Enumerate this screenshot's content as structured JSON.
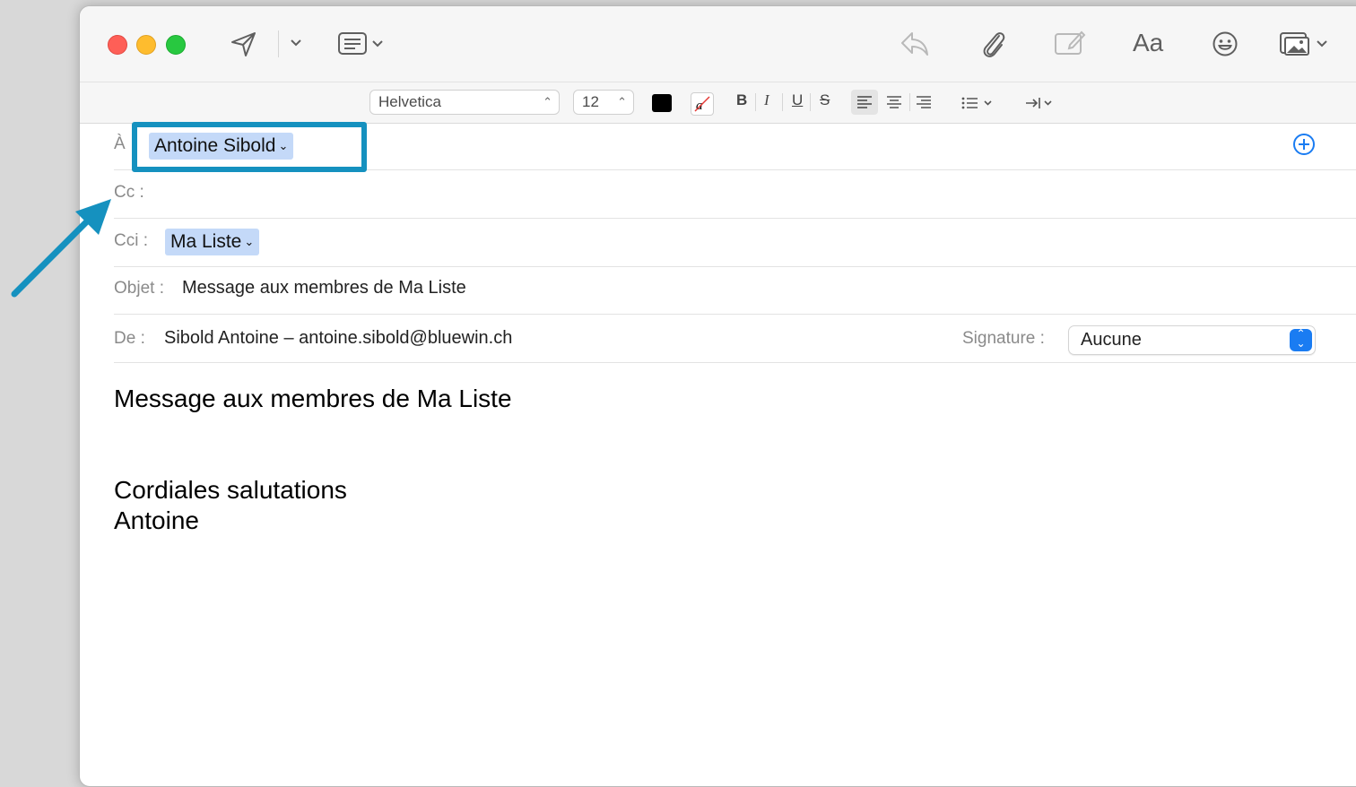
{
  "toolbar": {
    "font_size_glyph": "Aa",
    "icons": [
      "send-icon",
      "chevron-down-icon",
      "header-fields-icon",
      "reply-icon",
      "attachment-icon",
      "markup-icon",
      "font-icon",
      "emoji-icon",
      "photo-browser-icon"
    ]
  },
  "format_bar": {
    "font_family": "Helvetica",
    "font_size": "12",
    "text_color": "#000000",
    "bold": "B",
    "italic": "I",
    "underline": "U",
    "strikethrough": "S"
  },
  "fields": {
    "to_label": "À",
    "to_recipient": "Antoine Sibold",
    "cc_label": "Cc :",
    "bcc_label": "Cci :",
    "bcc_recipient": "Ma Liste",
    "subject_label": "Objet :",
    "subject_value": "Message aux membres de Ma Liste",
    "from_label": "De :",
    "from_value": "Sibold Antoine – antoine.sibold@bluewin.ch",
    "signature_label": "Signature :",
    "signature_value": "Aucune"
  },
  "message_body": {
    "line1": "Message aux membres de Ma Liste",
    "line2": "Cordiales salutations",
    "line3": "Antoine"
  },
  "annotation": {
    "highlight_color": "#1591bf"
  }
}
